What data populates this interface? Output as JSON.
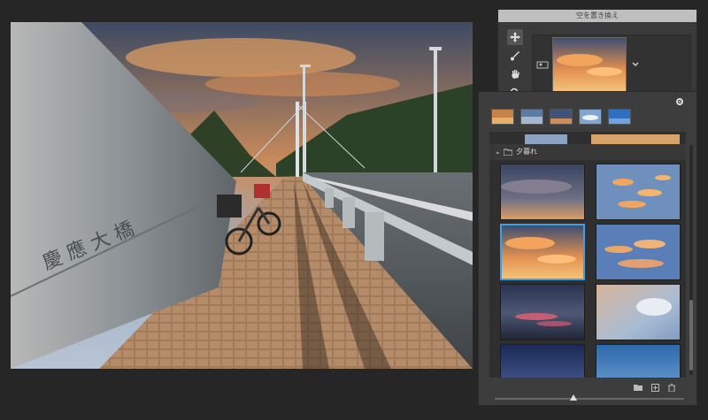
{
  "dialog": {
    "title": "空を置き換え",
    "tools": [
      "move-icon",
      "brush-icon",
      "hand-icon",
      "zoom-icon"
    ]
  },
  "panel": {
    "group_name": "夕暮れ",
    "gear_label": "⚙",
    "bottom_icons": [
      "folder-icon",
      "add-icon",
      "trash-icon"
    ]
  },
  "photo": {
    "inscription": "慶 應 大 橋"
  }
}
